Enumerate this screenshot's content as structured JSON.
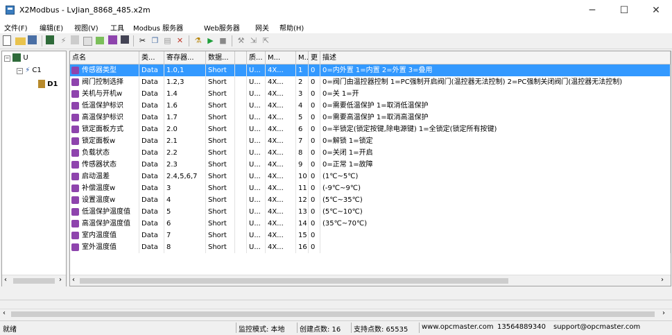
{
  "window": {
    "title": "X2Modbus - LvJian_8868_485.x2m",
    "minimize": "─",
    "maximize": "☐",
    "close": "✕"
  },
  "menu": [
    "文件(F)",
    "编辑(E)",
    "视图(V)",
    "工具",
    "Modbus 服务器",
    "Web服务器",
    "网关",
    "帮助(H)"
  ],
  "toolbar_icons": [
    "new-icon",
    "open-icon",
    "save-icon",
    "channel-icon",
    "separator",
    "device-icon",
    "tag-icon",
    "import-icon",
    "export-icon",
    "settings-icon",
    "separator",
    "cut-icon",
    "copy-icon",
    "paste-icon",
    "delete-icon",
    "separator",
    "monitor-icon",
    "run-icon",
    "stop-icon",
    "separator",
    "tools-icon",
    "import-icon",
    "export-icon"
  ],
  "tree": {
    "root": "U",
    "channel": "C1",
    "device": "D1"
  },
  "grid": {
    "headers": [
      "点名",
      "类...",
      "寄存器...",
      "数据...",
      "",
      "质...",
      "M...",
      "M...",
      "更",
      "描述"
    ],
    "rows": [
      {
        "name": "传感器类型",
        "type": "Data",
        "reg": "1.0,1",
        "dtype": "Short",
        "q": "U...",
        "m1": "4X...",
        "m2": "1",
        "u": "0",
        "desc": "0=内外置 1=内置 2=外置 3=叠用",
        "selected": true
      },
      {
        "name": "阀门控制选择",
        "type": "Data",
        "reg": "1.2,3",
        "dtype": "Short",
        "q": "U...",
        "m1": "4X...",
        "m2": "2",
        "u": "0",
        "desc": "0=阀门由温控器控制 1=PC强制开启阀门(温控器无法控制) 2=PC强制关闭阀门(温控器无法控制)"
      },
      {
        "name": "关机与开机w",
        "type": "Data",
        "reg": "1.4",
        "dtype": "Short",
        "q": "U...",
        "m1": "4X...",
        "m2": "3",
        "u": "0",
        "desc": "0=关 1=开"
      },
      {
        "name": "低温保护标识",
        "type": "Data",
        "reg": "1.6",
        "dtype": "Short",
        "q": "U...",
        "m1": "4X...",
        "m2": "4",
        "u": "0",
        "desc": "0=需要低温保护 1=取消低温保护"
      },
      {
        "name": "高温保护标识",
        "type": "Data",
        "reg": "1.7",
        "dtype": "Short",
        "q": "U...",
        "m1": "4X...",
        "m2": "5",
        "u": "0",
        "desc": "0=需要高温保护 1=取消高温保护"
      },
      {
        "name": "锁定面板方式",
        "type": "Data",
        "reg": "2.0",
        "dtype": "Short",
        "q": "U...",
        "m1": "4X...",
        "m2": "6",
        "u": "0",
        "desc": "0=半锁定(锁定按键,除电源键) 1=全锁定(锁定所有按键)"
      },
      {
        "name": "锁定面板w",
        "type": "Data",
        "reg": "2.1",
        "dtype": "Short",
        "q": "U...",
        "m1": "4X...",
        "m2": "7",
        "u": "0",
        "desc": "0=解锁 1=锁定"
      },
      {
        "name": "负载状态",
        "type": "Data",
        "reg": "2.2",
        "dtype": "Short",
        "q": "U...",
        "m1": "4X...",
        "m2": "8",
        "u": "0",
        "desc": "0=关闭 1=开启"
      },
      {
        "name": "传感器状态",
        "type": "Data",
        "reg": "2.3",
        "dtype": "Short",
        "q": "U...",
        "m1": "4X...",
        "m2": "9",
        "u": "0",
        "desc": "0=正常 1=故障"
      },
      {
        "name": "启动温差",
        "type": "Data",
        "reg": "2.4,5,6,7",
        "dtype": "Short",
        "q": "U...",
        "m1": "4X...",
        "m2": "10",
        "u": "0",
        "desc": "(1℃~5℃)"
      },
      {
        "name": "补偿温度w",
        "type": "Data",
        "reg": "3",
        "dtype": "Short",
        "q": "U...",
        "m1": "4X...",
        "m2": "11",
        "u": "0",
        "desc": "(-9℃~9℃)"
      },
      {
        "name": "设置温度w",
        "type": "Data",
        "reg": "4",
        "dtype": "Short",
        "q": "U...",
        "m1": "4X...",
        "m2": "12",
        "u": "0",
        "desc": "(5℃~35℃)"
      },
      {
        "name": "低温保护温度值",
        "type": "Data",
        "reg": "5",
        "dtype": "Short",
        "q": "U...",
        "m1": "4X...",
        "m2": "13",
        "u": "0",
        "desc": "(5℃~10℃)"
      },
      {
        "name": "高温保护温度值",
        "type": "Data",
        "reg": "6",
        "dtype": "Short",
        "q": "U...",
        "m1": "4X...",
        "m2": "14",
        "u": "0",
        "desc": "(35℃~70℃)"
      },
      {
        "name": "室内温度值",
        "type": "Data",
        "reg": "7",
        "dtype": "Short",
        "q": "U...",
        "m1": "4X...",
        "m2": "15",
        "u": "0",
        "desc": ""
      },
      {
        "name": "室外温度值",
        "type": "Data",
        "reg": "8",
        "dtype": "Short",
        "q": "U...",
        "m1": "4X...",
        "m2": "16",
        "u": "0",
        "desc": ""
      }
    ]
  },
  "status": {
    "ready": "就绪",
    "mode": "监控模式: 本地",
    "created": "创建点数: 16",
    "supported": "支持点数: 65535",
    "web": "www.opcmaster.com",
    "phone": "13564889340",
    "email": "support@opcmaster.com"
  },
  "colors": {
    "selection": "#3399ff",
    "tag_icon": "#8e44ad"
  }
}
